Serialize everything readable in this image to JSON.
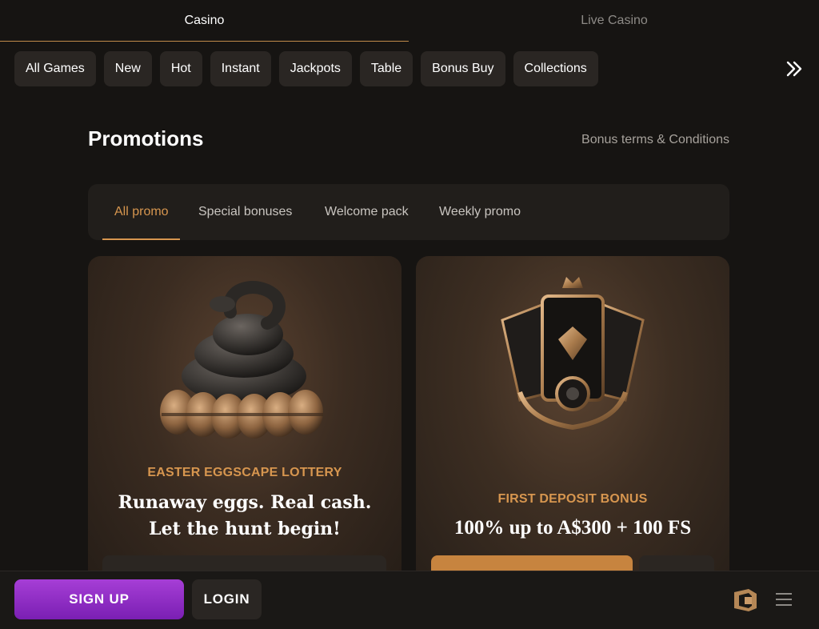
{
  "top_tabs": {
    "casino": "Casino",
    "live_casino": "Live Casino"
  },
  "categories": [
    "All Games",
    "New",
    "Hot",
    "Instant",
    "Jackpots",
    "Table",
    "Bonus Buy",
    "Collections"
  ],
  "icons": {
    "next": "double-chevron-right-icon",
    "menu": "hamburger-menu-icon",
    "logo": "brand-logo-icon"
  },
  "promotions": {
    "title": "Promotions",
    "terms_link": "Bonus terms & Conditions",
    "filter_tabs": [
      "All promo",
      "Special bonuses",
      "Welcome pack",
      "Weekly promo"
    ],
    "active_filter": "All promo"
  },
  "cards": [
    {
      "label": "EASTER EGGSCAPE LOTTERY",
      "headline_line1": "Runaway eggs. Real cash.",
      "headline_line2": "Let the hunt begin!"
    },
    {
      "label": "FIRST DEPOSIT BONUS",
      "headline": "100% up to A$300 + 100 FS"
    }
  ],
  "bottom_bar": {
    "signup": "SIGN UP",
    "login": "LOGIN"
  },
  "colors": {
    "accent": "#d7964f",
    "signup": "#8e2cc6",
    "background": "#161412",
    "chip": "#2a2623"
  }
}
